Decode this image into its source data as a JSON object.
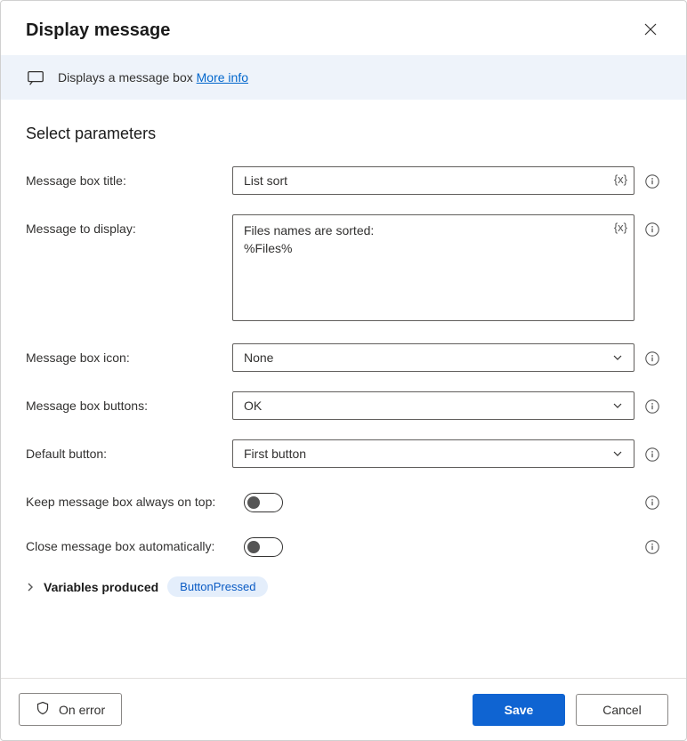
{
  "header": {
    "title": "Display message"
  },
  "banner": {
    "description": "Displays a message box ",
    "link_text": "More info"
  },
  "section": {
    "title": "Select parameters"
  },
  "fields": {
    "title": {
      "label": "Message box title:",
      "value": "List sort"
    },
    "message": {
      "label": "Message to display:",
      "value": "Files names are sorted:\n%Files%"
    },
    "icon": {
      "label": "Message box icon:",
      "value": "None"
    },
    "buttons": {
      "label": "Message box buttons:",
      "value": "OK"
    },
    "default_button": {
      "label": "Default button:",
      "value": "First button"
    },
    "always_on_top": {
      "label": "Keep message box always on top:"
    },
    "auto_close": {
      "label": "Close message box automatically:"
    }
  },
  "variables": {
    "label": "Variables produced",
    "chip": "ButtonPressed"
  },
  "var_token": "{x}",
  "footer": {
    "on_error": "On error",
    "save": "Save",
    "cancel": "Cancel"
  }
}
